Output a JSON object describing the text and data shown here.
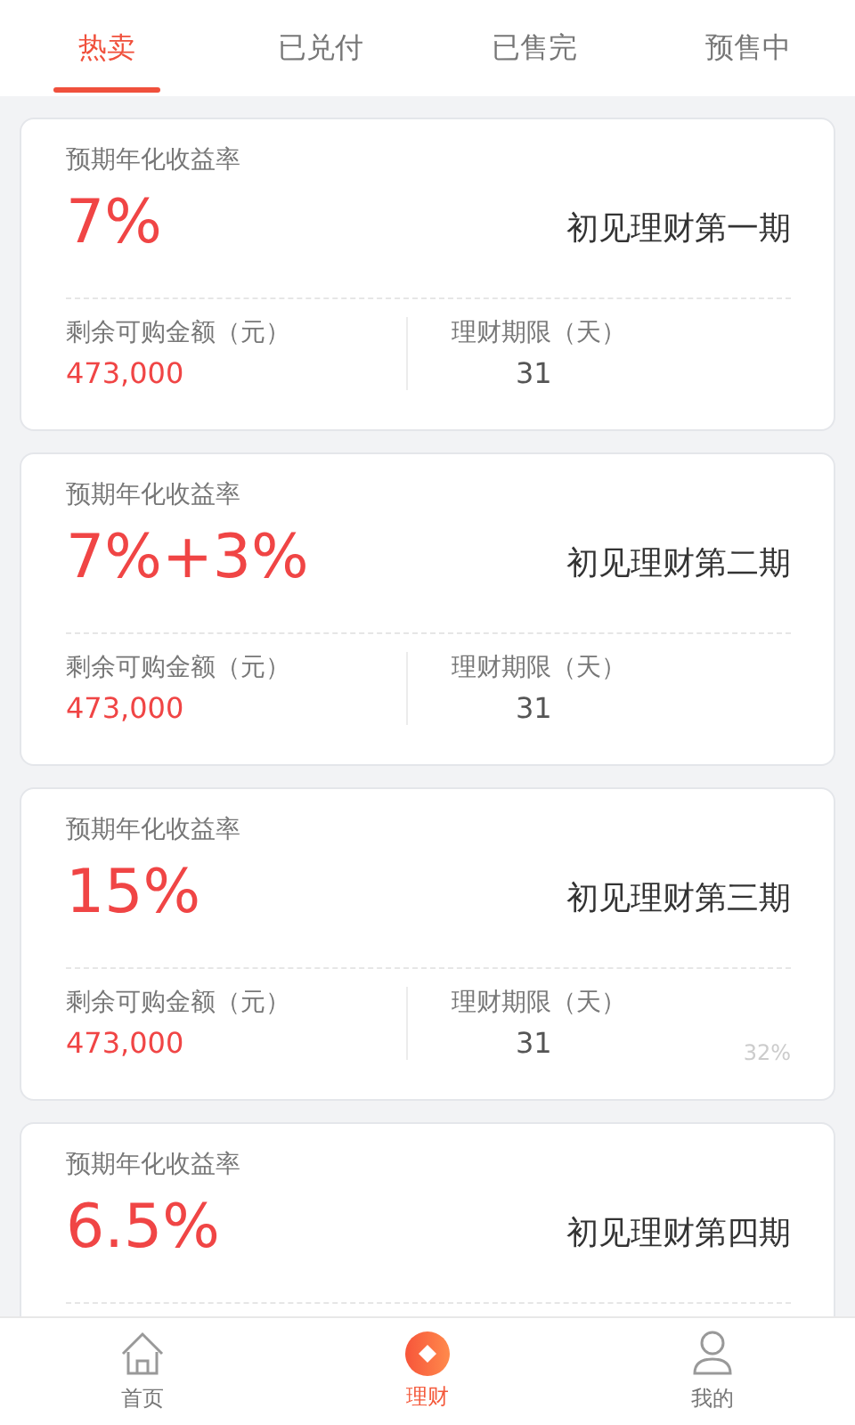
{
  "tabs": [
    {
      "label": "热卖",
      "selected": true
    },
    {
      "label": "已兑付",
      "selected": false
    },
    {
      "label": "已售完",
      "selected": false
    },
    {
      "label": "预售中",
      "selected": false
    }
  ],
  "products": [
    {
      "rate_label": "预期年化收益率",
      "rate": "7%",
      "title": "初见理财第一期",
      "amount_label": "剩余可购金额（元）",
      "amount": "473,000",
      "term_label": "理财期限（天）",
      "term": "31"
    },
    {
      "rate_label": "预期年化收益率",
      "rate": "7%+3%",
      "title": "初见理财第二期",
      "amount_label": "剩余可购金额（元）",
      "amount": "473,000",
      "term_label": "理财期限（天）",
      "term": "31"
    },
    {
      "rate_label": "预期年化收益率",
      "rate": "15%",
      "title": "初见理财第三期",
      "amount_label": "剩余可购金额（元）",
      "amount": "473,000",
      "term_label": "理财期限（天）",
      "term": "31",
      "progress": "32%"
    },
    {
      "rate_label": "预期年化收益率",
      "rate": "6.5%",
      "title": "初见理财第四期"
    }
  ],
  "bottom_nav": [
    {
      "label": "首页",
      "kind": "home",
      "selected": false
    },
    {
      "label": "理财",
      "kind": "finance",
      "selected": true
    },
    {
      "label": "我的",
      "kind": "user",
      "selected": false
    }
  ]
}
